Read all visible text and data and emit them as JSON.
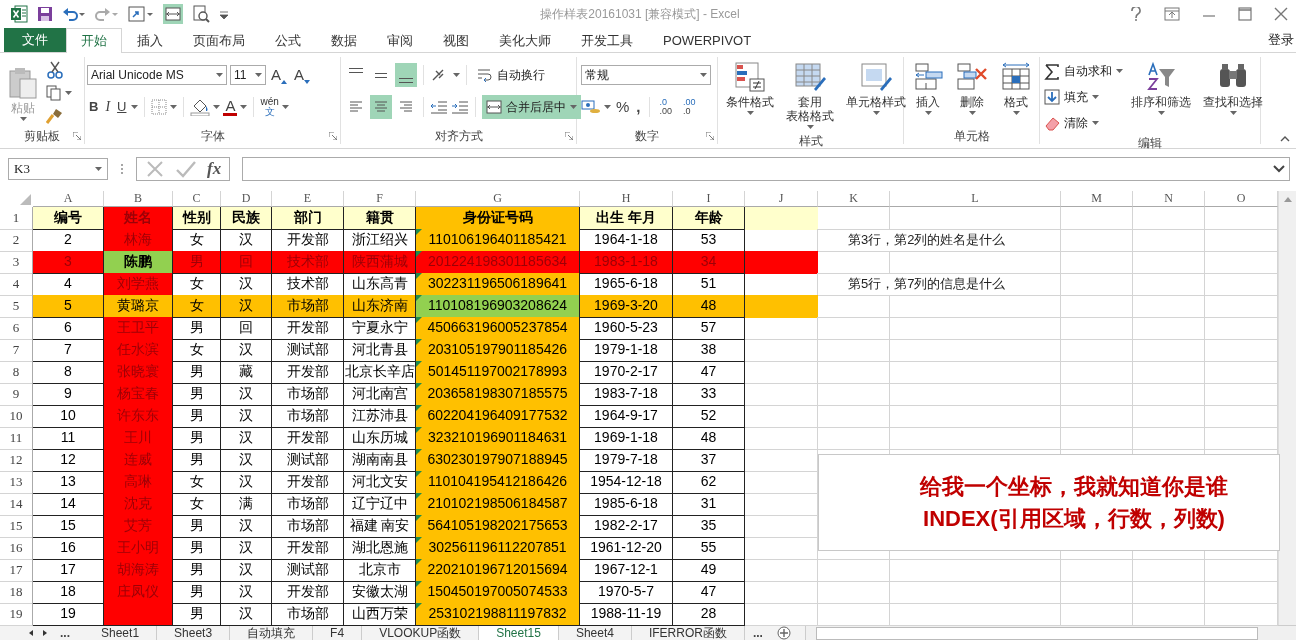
{
  "title_bar": {
    "title": "操作样表20161031  [兼容模式] - Excel"
  },
  "menu_tabs": [
    {
      "label": "文件",
      "kind": "file",
      "selected": false
    },
    {
      "label": "开始",
      "kind": "tab",
      "selected": true
    },
    {
      "label": "插入",
      "kind": "tab",
      "selected": false
    },
    {
      "label": "页面布局",
      "kind": "tab",
      "selected": false
    },
    {
      "label": "公式",
      "kind": "tab",
      "selected": false
    },
    {
      "label": "数据",
      "kind": "tab",
      "selected": false
    },
    {
      "label": "审阅",
      "kind": "tab",
      "selected": false
    },
    {
      "label": "视图",
      "kind": "tab",
      "selected": false
    },
    {
      "label": "美化大师",
      "kind": "tab",
      "selected": false
    },
    {
      "label": "开发工具",
      "kind": "tab",
      "selected": false
    },
    {
      "label": "POWERPIVOT",
      "kind": "tab",
      "selected": false
    }
  ],
  "account": "登录",
  "ribbon": {
    "clipboard": {
      "label": "剪贴板",
      "paste": "粘贴"
    },
    "font": {
      "label": "字体",
      "name": "Arial Unicode MS",
      "size": "11",
      "grow": "A",
      "shrink": "A",
      "bold": "B",
      "italic": "I",
      "underline": "U",
      "font_color": "A",
      "phonetic_top": "wén",
      "phonetic_bottom": "文"
    },
    "alignment": {
      "label": "对齐方式",
      "vertical": [
        {
          "kind": "top",
          "selected": false
        },
        {
          "kind": "middle",
          "selected": false
        },
        {
          "kind": "bottom",
          "selected": true
        }
      ],
      "horizontal": [
        {
          "kind": "left",
          "selected": false
        },
        {
          "kind": "center",
          "selected": true
        },
        {
          "kind": "right",
          "selected": false
        }
      ],
      "wrap_text": {
        "label": "自动换行",
        "selected": false
      },
      "merge_center": {
        "label": "合并后居中",
        "selected": true
      }
    },
    "number": {
      "label": "数字",
      "format": "常规",
      "percent": "%",
      "comma": ",",
      "decimals": [
        {
          "top": ".0",
          "bottom": ".00"
        },
        {
          "top": ".00",
          "bottom": ".0"
        }
      ]
    },
    "styles": {
      "label": "样式",
      "buttons": [
        {
          "kind": "conditional",
          "lines": [
            "条件格式"
          ]
        },
        {
          "kind": "table",
          "lines": [
            "套用",
            "表格格式"
          ]
        },
        {
          "kind": "cellstyle",
          "lines": [
            "单元格样式"
          ]
        }
      ]
    },
    "cells": {
      "label": "单元格",
      "buttons": [
        {
          "kind": "insert",
          "lines": [
            "插入"
          ]
        },
        {
          "kind": "delete",
          "lines": [
            "删除"
          ]
        },
        {
          "kind": "format",
          "lines": [
            "格式"
          ]
        }
      ]
    },
    "editing": {
      "label": "编辑",
      "small": [
        {
          "kind": "sum",
          "label": "自动求和"
        },
        {
          "kind": "fill",
          "label": "填充"
        },
        {
          "kind": "clear",
          "label": "清除"
        }
      ],
      "big": [
        {
          "kind": "sort",
          "label": "排序和筛选"
        },
        {
          "kind": "find",
          "label": "查找和选择"
        }
      ]
    }
  },
  "formula_bar": {
    "name_box": "K3",
    "fx": "fx"
  },
  "sheet": {
    "columns": [
      {
        "letter": "A"
      },
      {
        "letter": "B",
        "color": "#ff0000"
      },
      {
        "letter": "C"
      },
      {
        "letter": "D"
      },
      {
        "letter": "E"
      },
      {
        "letter": "F"
      },
      {
        "letter": "G",
        "color": "#ffc000",
        "flagged": true
      },
      {
        "letter": "H"
      },
      {
        "letter": "I"
      },
      {
        "letter": "J"
      },
      {
        "letter": "K"
      },
      {
        "letter": "L"
      },
      {
        "letter": "M"
      },
      {
        "letter": "N"
      },
      {
        "letter": "O"
      }
    ],
    "rows": [
      {
        "number": "1",
        "kind": "header",
        "color": "#ffffcc",
        "cells": [
          "编号",
          {
            "text": "姓名",
            "color": "#ff0000"
          },
          "性别",
          "民族",
          "部门",
          "籍贯",
          {
            "text": "身份证号码",
            "color": "#ffc000"
          },
          "出生 年月",
          "年龄"
        ]
      },
      {
        "number": "2",
        "kind": "data",
        "cells": [
          "2",
          "林海",
          "女",
          "汉",
          "开发部",
          "浙江绍兴",
          "110106196401185421",
          "1964-1-18",
          "53"
        ],
        "note": "第3行，第2列的姓名是什么"
      },
      {
        "number": "3",
        "kind": "data",
        "color": "#ff0000",
        "cells": [
          "3",
          {
            "text": "陈鹏",
            "color": "#92d050",
            "bold": true
          },
          "男",
          "回",
          "技术部",
          "陕西蒲城",
          "201224198301185634",
          "1983-1-18",
          "34"
        ]
      },
      {
        "number": "4",
        "kind": "data",
        "cells": [
          "4",
          "刘学燕",
          "女",
          "汉",
          "技术部",
          "山东高青",
          "302231196506189641",
          "1965-6-18",
          "51"
        ],
        "note": "第5行，第7列的信息是什么"
      },
      {
        "number": "5",
        "kind": "data",
        "color": "#ffc000",
        "cells": [
          "5",
          "黄璐京",
          "女",
          "汉",
          "市场部",
          "山东济南",
          {
            "text": "110108196903208624",
            "color": "#92d050"
          },
          "1969-3-20",
          "48"
        ]
      },
      {
        "number": "6",
        "kind": "data",
        "cells": [
          "6",
          "王卫平",
          "男",
          "回",
          "开发部",
          "宁夏永宁",
          "450663196005237854",
          "1960-5-23",
          "57"
        ]
      },
      {
        "number": "7",
        "kind": "data",
        "cells": [
          "7",
          "任水滨",
          "女",
          "汉",
          "测试部",
          "河北青县",
          "203105197901185426",
          "1979-1-18",
          "38"
        ]
      },
      {
        "number": "8",
        "kind": "data",
        "cells": [
          "8",
          "张晓寰",
          "男",
          "藏",
          "开发部",
          "北京长辛店",
          "501451197002178993",
          "1970-2-17",
          "47"
        ]
      },
      {
        "number": "9",
        "kind": "data",
        "cells": [
          "9",
          "杨宝春",
          "男",
          "汉",
          "市场部",
          "河北南宫",
          "203658198307185575",
          "1983-7-18",
          "33"
        ]
      },
      {
        "number": "10",
        "kind": "data",
        "cells": [
          "10",
          "许东东",
          "男",
          "汉",
          "市场部",
          "江苏沛县",
          "602204196409177532",
          "1964-9-17",
          "52"
        ]
      },
      {
        "number": "11",
        "kind": "data",
        "cells": [
          "11",
          "王川",
          "男",
          "汉",
          "开发部",
          "山东历城",
          "323210196901184631",
          "1969-1-18",
          "48"
        ]
      },
      {
        "number": "12",
        "kind": "data",
        "cells": [
          "12",
          "连威",
          "男",
          "汉",
          "测试部",
          "湖南南县",
          "630230197907188945",
          "1979-7-18",
          "37"
        ]
      },
      {
        "number": "13",
        "kind": "data",
        "cells": [
          "13",
          "高琳",
          "女",
          "汉",
          "开发部",
          "河北文安",
          "110104195412186426",
          "1954-12-18",
          "62"
        ]
      },
      {
        "number": "14",
        "kind": "data",
        "cells": [
          "14",
          "沈克",
          "女",
          "满",
          "市场部",
          "辽宁辽中",
          "210102198506184587",
          "1985-6-18",
          "31"
        ]
      },
      {
        "number": "15",
        "kind": "data",
        "cells": [
          "15",
          "艾芳",
          "男",
          "汉",
          "市场部",
          "福建  南安",
          "564105198202175653",
          "1982-2-17",
          "35"
        ]
      },
      {
        "number": "16",
        "kind": "data",
        "cells": [
          "16",
          "王小明",
          "男",
          "汉",
          "开发部",
          "湖北恩施",
          "302561196112207851",
          "1961-12-20",
          "55"
        ]
      },
      {
        "number": "17",
        "kind": "data",
        "cells": [
          "17",
          "胡海涛",
          "男",
          "汉",
          "测试部",
          "北京市",
          "220210196712015694",
          "1967-12-1",
          "49"
        ]
      },
      {
        "number": "18",
        "kind": "data",
        "cells": [
          "18",
          "庄凤仪",
          "男",
          "汉",
          "开发部",
          "安徽太湖",
          "150450197005074533",
          "1970-5-7",
          "47"
        ]
      },
      {
        "number": "19",
        "kind": "data",
        "cells": [
          "19",
          null,
          "男",
          "汉",
          "市场部",
          "山西万荣",
          "253102198811197832",
          "1988-11-19",
          "28"
        ]
      }
    ],
    "callout": {
      "lines": [
        "给我一个坐标，我就知道你是谁",
        "INDEX(引用区域，行数，列数)"
      ]
    }
  },
  "sheet_tabs": {
    "overflow_left": "...",
    "overflow_right": "...",
    "tabs": [
      {
        "label": "Sheet1",
        "selected": false
      },
      {
        "label": "Sheet3",
        "selected": false
      },
      {
        "label": "自动填充",
        "selected": false
      },
      {
        "label": "F4",
        "selected": false
      },
      {
        "label": "VLOOKUP函数",
        "selected": false
      },
      {
        "label": "Sheet15",
        "selected": true
      },
      {
        "label": "Sheet4",
        "selected": false
      },
      {
        "label": "IFERROR函数",
        "selected": false
      }
    ]
  }
}
